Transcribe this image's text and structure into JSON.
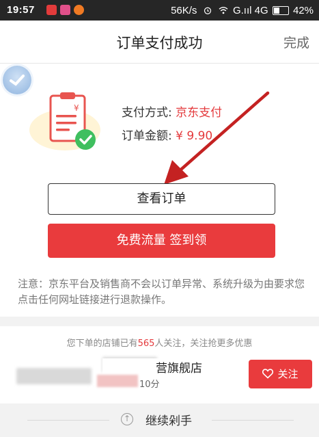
{
  "status_bar": {
    "time": "19:57",
    "speed": "56K/s",
    "network": "G.ııl 4G",
    "battery": "42%"
  },
  "header": {
    "title": "订单支付成功",
    "done_label": "完成"
  },
  "payment": {
    "method_label": "支付方式:",
    "method_value": "京东支付",
    "amount_label": "订单金额:",
    "amount_value": "¥ 9.90"
  },
  "buttons": {
    "view_order": "查看订单",
    "free_traffic": "免费流量 签到领",
    "follow": "关注"
  },
  "notice": "注意：京东平台及销售商不会以订单异常、系统升级为由要求您点击任何网址链接进行退款操作。",
  "shop": {
    "hint_prefix": "您下单的店铺已有",
    "follower_count": "565",
    "hint_suffix": "人关注，关注抢更多优惠",
    "name_suffix": "营旗舰店",
    "score": "10分"
  },
  "bottom": {
    "continue_label": "继续剁手"
  },
  "colors": {
    "accent": "#e93b3d",
    "status_bar": "#262626",
    "arrow": "#c42222"
  },
  "icons": [
    "alarm-icon",
    "wifi-icon",
    "signal-icon",
    "battery-icon",
    "clipboard-check-icon",
    "heart-icon",
    "arrow-up-circle-icon"
  ]
}
